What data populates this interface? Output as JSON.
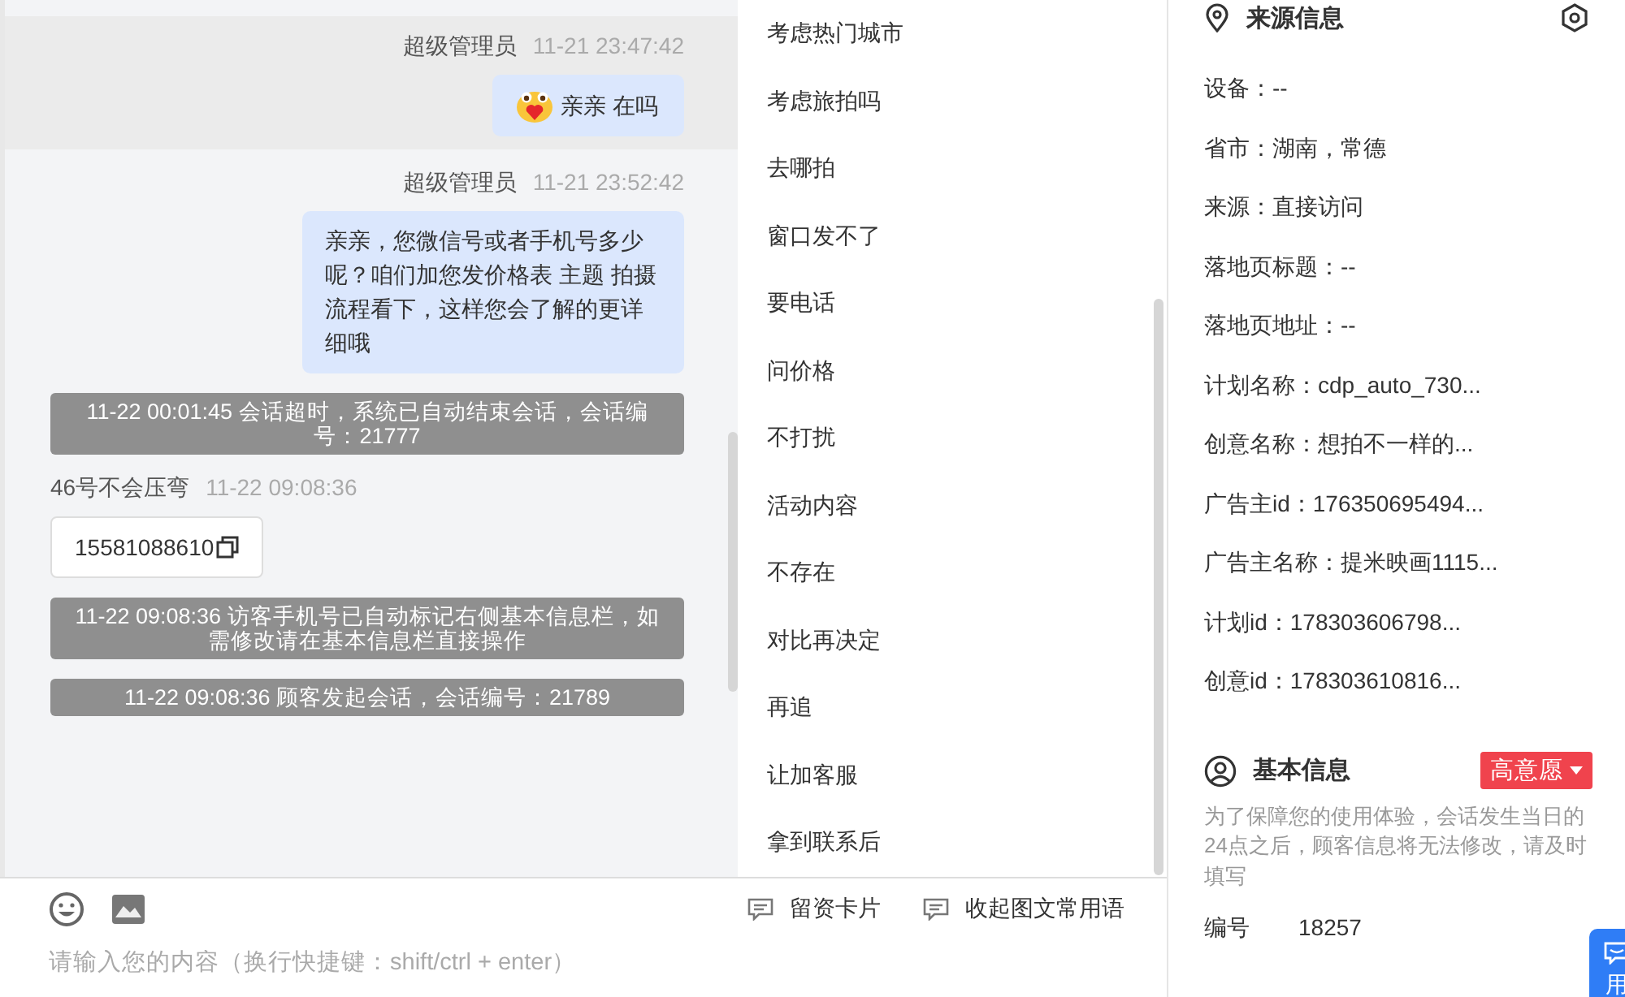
{
  "messages": [
    {
      "kind": "agent",
      "sender": "超级管理员",
      "time": "11-21 23:47:42",
      "text": "亲亲  在吗",
      "emoji": true,
      "highlighted": true
    },
    {
      "kind": "agent",
      "sender": "超级管理员",
      "time": "11-21 23:52:42",
      "text": "亲亲，您微信号或者手机号多少呢？咱们加您发价格表 主题 拍摄流程看下，这样您会了解的更详细哦",
      "emoji": false,
      "highlighted": false
    },
    {
      "kind": "system",
      "text": "11-22 00:01:45 会话超时，系统已自动结束会话，会话编号：21777"
    },
    {
      "kind": "visitor",
      "sender": "46号不会压弯",
      "time": "11-22 09:08:36",
      "text": "15581088610"
    },
    {
      "kind": "system",
      "text": "11-22 09:08:36 访客手机号已自动标记右侧基本信息栏，如需修改请在基本信息栏直接操作"
    },
    {
      "kind": "system",
      "text": "11-22 09:08:36 顾客发起会话，会话编号：21789"
    }
  ],
  "quick_replies": [
    "考虑热门城市",
    "考虑旅拍吗",
    "去哪拍",
    "窗口发不了",
    "要电话",
    "问价格",
    "不打扰",
    "活动内容",
    "不存在",
    "对比再决定",
    "再追",
    "让加客服",
    "拿到联系后"
  ],
  "composer": {
    "actions": [
      "留资卡片",
      "收起图文常用语"
    ],
    "placeholder": "请输入您的内容（换行快捷键：shift/ctrl + enter）"
  },
  "source_info": {
    "title": "来源信息",
    "rows": [
      "设备：--",
      "省市：湖南，常德",
      "来源：直接访问",
      "落地页标题：--",
      "落地页地址：--",
      "计划名称：cdp_auto_730...",
      "创意名称：想拍不一样的...",
      "广告主id：176350695494...",
      "广告主名称：提米映画1115...",
      "计划id：178303606798...",
      "创意id：178303610816..."
    ]
  },
  "basic_info": {
    "title": "基本信息",
    "intent_tag": "高意愿",
    "note": "为了保障您的使用体验，会话发生当日的24点之后，顾客信息将无法修改，请及时填写",
    "fields": [
      {
        "label": "编号",
        "value": "18257"
      }
    ]
  },
  "floating_button": "用"
}
